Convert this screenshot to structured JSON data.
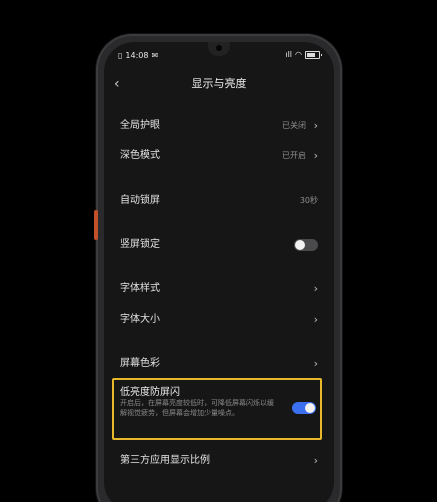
{
  "statusbar": {
    "time": "14:08",
    "signal": "ıll"
  },
  "header": {
    "back": "‹",
    "title": "显示与亮度"
  },
  "settings": {
    "global_eye": {
      "label": "全局护眼",
      "value": "已关闭"
    },
    "dark_mode": {
      "label": "深色模式",
      "value": "已开启"
    },
    "auto_lock": {
      "label": "自动锁屏",
      "value": "30秒"
    },
    "portrait_lock": {
      "label": "竖屏锁定",
      "toggle": "off"
    },
    "font_style": {
      "label": "字体样式"
    },
    "font_size": {
      "label": "字体大小"
    },
    "screen_color": {
      "label": "屏幕色彩"
    },
    "anti_flicker": {
      "label": "低亮度防屏闪",
      "desc": "开启后，在屏幕亮度较低时，可降低屏幕闪烁以缓解视觉疲劳，但屏幕会增加少量噪点。",
      "toggle": "on"
    },
    "third_party_ratio": {
      "label": "第三方应用显示比例"
    }
  },
  "icons": {
    "chevron": "›"
  },
  "colors": {
    "highlight_border": "#e9b82a",
    "toggle_on": "#3b6ff0",
    "toggle_off": "#4a4a4c",
    "accent_button": "#c2502a"
  }
}
